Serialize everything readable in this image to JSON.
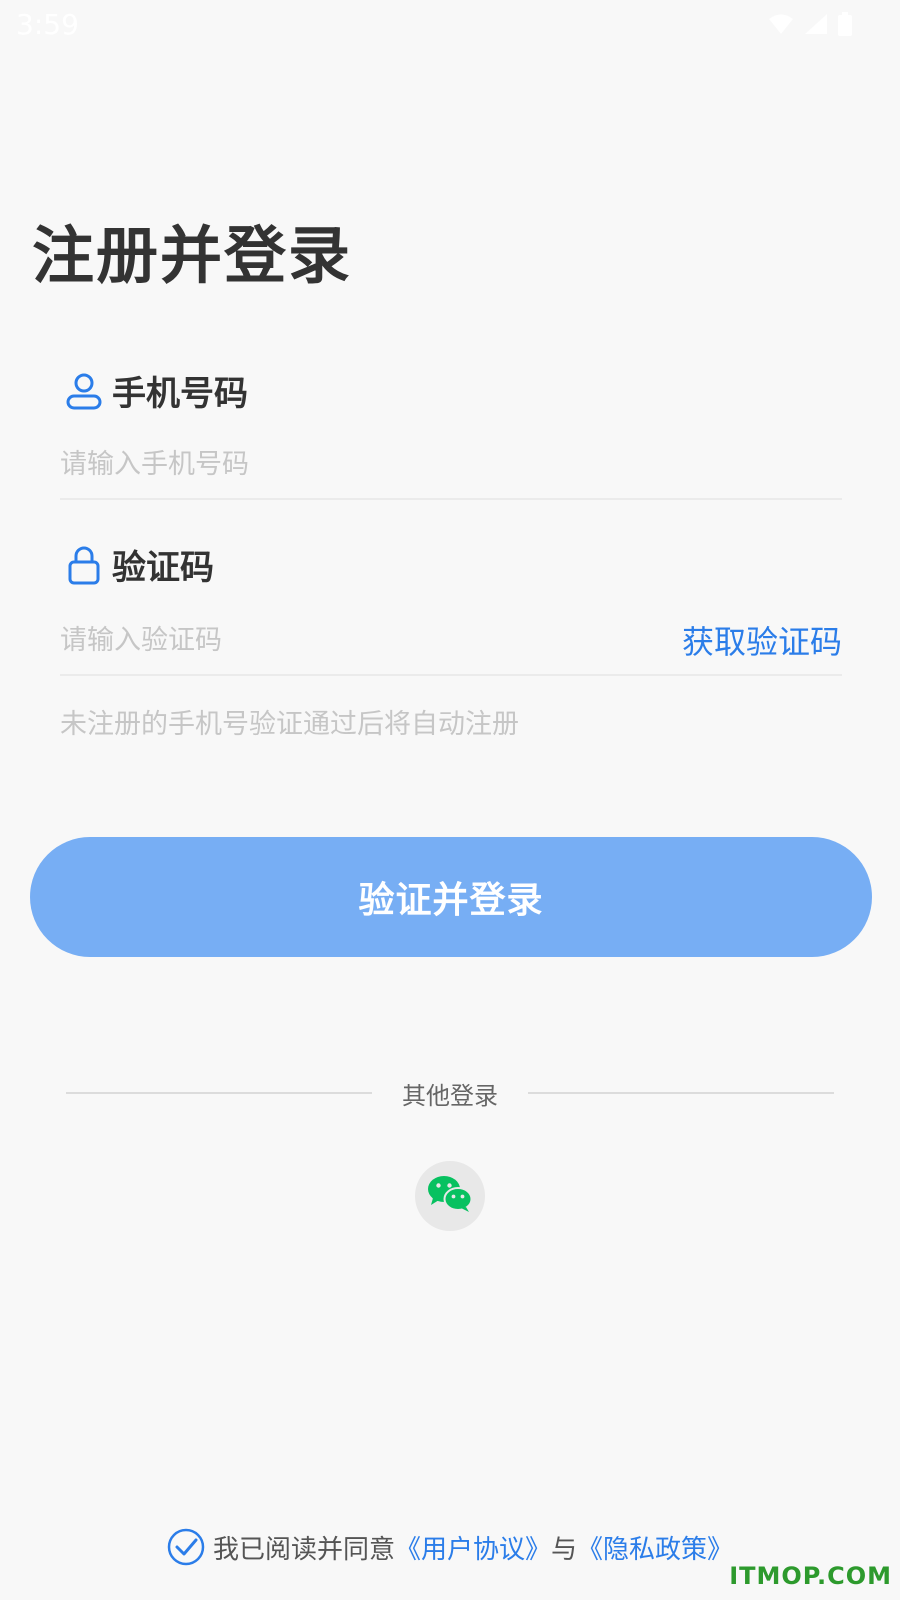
{
  "status_bar": {
    "time": "3:59"
  },
  "page": {
    "title": "注册并登录"
  },
  "phone": {
    "label": "手机号码",
    "placeholder": "请输入手机号码",
    "value": ""
  },
  "code": {
    "label": "验证码",
    "placeholder": "请输入验证码",
    "value": "",
    "get_code_label": "获取验证码"
  },
  "hint": "未注册的手机号验证通过后将自动注册",
  "login_button": "验证并登录",
  "other_login": {
    "label": "其他登录",
    "options": [
      "wechat-icon"
    ]
  },
  "agreement": {
    "prefix": "我已阅读并同意",
    "user_agreement": "《用户协议》",
    "conjunction": "与",
    "privacy_policy": "《隐私政策》",
    "checked": true
  },
  "watermark": "ITMOP.COM",
  "colors": {
    "accent": "#2b7de9",
    "button": "#77aef4",
    "wechat": "#07c160",
    "background": "#f8f8f8"
  }
}
